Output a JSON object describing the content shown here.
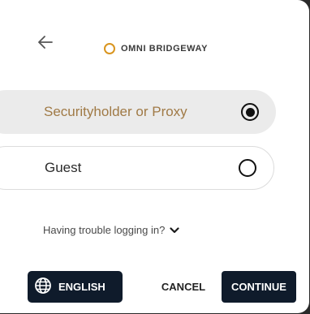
{
  "header": {
    "back_icon": "arrow-left-icon",
    "logo_text": "OMNI BRIDGEWAY",
    "logo_color": "#d9951f"
  },
  "options": [
    {
      "label": "Securityholder or Proxy",
      "selected": true
    },
    {
      "label": "Guest",
      "selected": false
    }
  ],
  "help": {
    "trouble_label": "Having trouble logging in?",
    "icon": "chevron-down-icon"
  },
  "footer": {
    "language_label": "ENGLISH",
    "language_icon": "globe-icon",
    "cancel_label": "CANCEL",
    "continue_label": "CONTINUE"
  },
  "colors": {
    "accent_text": "#a07a46",
    "selected_bg": "#ebebeb",
    "button_bg": "#0f1b2b"
  }
}
